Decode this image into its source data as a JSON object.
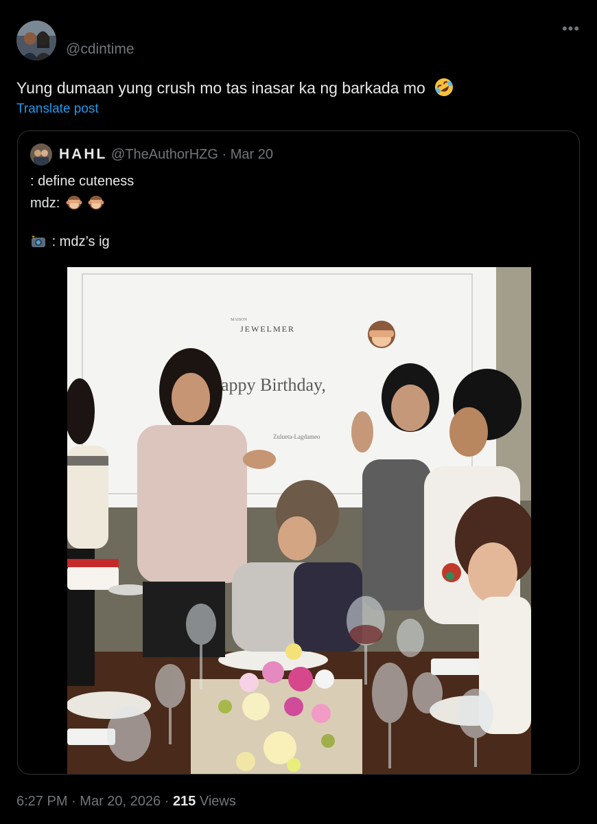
{
  "post": {
    "handle": "@cdintime",
    "text": "Yung dumaan yung crush mo tas inasar ka ng barkada mo",
    "translate_label": "Translate post",
    "more_label": "•••"
  },
  "quoted": {
    "display_name": "HAHL",
    "handle": "@TheAuthorHZG",
    "separator": "·",
    "date": "Mar 20",
    "line1": ": define cuteness",
    "line2": "mdz:",
    "line3": ": mdz’s ig",
    "photo": {
      "brand_small": "MAISON",
      "brand": "JEWELMER",
      "greeting": "appy Birthday,",
      "name_line": "Zulueta-Lagdameo"
    }
  },
  "footer": {
    "time": "6:27 PM",
    "separator": "·",
    "date": "Mar 20, 2026",
    "views_count": "215",
    "views_label": "Views"
  },
  "icons": {
    "laughing": "rolling-on-floor-laughing-emoji",
    "monkey": "see-no-evil-monkey-emoji",
    "camera": "camera-with-flash-emoji"
  }
}
